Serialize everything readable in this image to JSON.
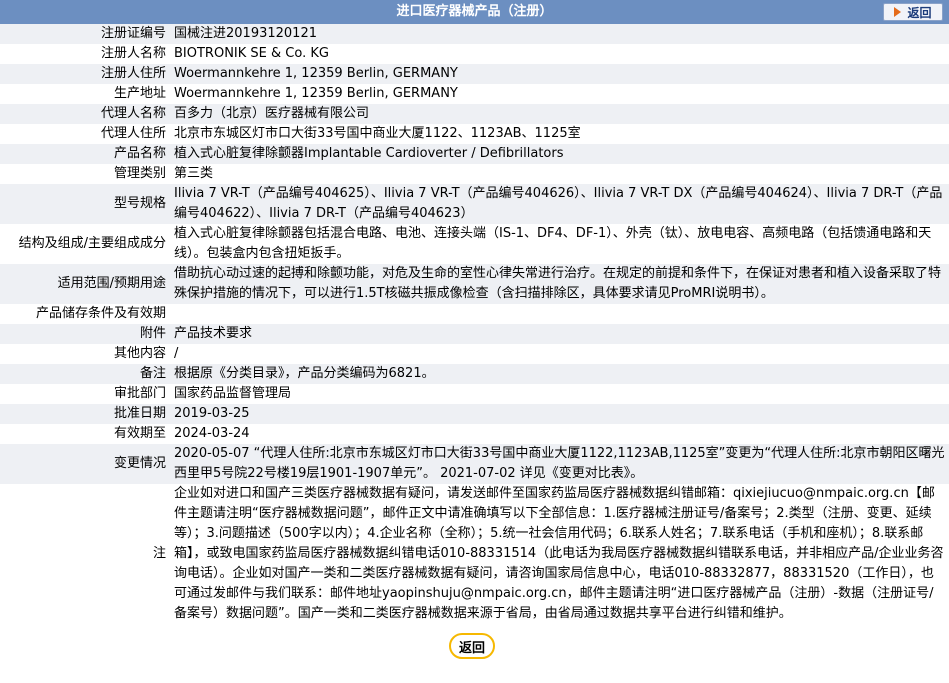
{
  "header": {
    "title": "进口医疗器械产品（注册）",
    "back_label": "返回"
  },
  "rows": [
    {
      "k": "注册证编号",
      "v": "国械注进20193120121"
    },
    {
      "k": "注册人名称",
      "v": "BIOTRONIK SE & Co. KG"
    },
    {
      "k": "注册人住所",
      "v": "Woermannkehre 1, 12359 Berlin, GERMANY"
    },
    {
      "k": "生产地址",
      "v": "Woermannkehre 1, 12359 Berlin, GERMANY"
    },
    {
      "k": "代理人名称",
      "v": "百多力（北京）医疗器械有限公司"
    },
    {
      "k": "代理人住所",
      "v": "北京市东城区灯市口大街33号国中商业大厦1122、1123AB、1125室"
    },
    {
      "k": "产品名称",
      "v": "植入式心脏复律除颤器Implantable Cardioverter / Defibrillators"
    },
    {
      "k": "管理类别",
      "v": "第三类"
    },
    {
      "k": "型号规格",
      "v": "Ilivia 7 VR-T（产品编号404625）、Ilivia 7 VR-T（产品编号404626）、Ilivia 7 VR-T DX（产品编号404624）、Ilivia 7 DR-T（产品编号404622）、Ilivia 7 DR-T（产品编号404623）"
    },
    {
      "k": "结构及组成/主要组成成分",
      "v": "植入式心脏复律除颤器包括混合电路、电池、连接头端（IS-1、DF4、DF-1）、外壳（钛）、放电电容、高频电路（包括馈通电路和天线）。包装盒内包含扭矩扳手。"
    },
    {
      "k": "适用范围/预期用途",
      "v": "借助抗心动过速的起搏和除颤功能，对危及生命的室性心律失常进行治疗。在规定的前提和条件下，在保证对患者和植入设备采取了特殊保护措施的情况下，可以进行1.5T核磁共振成像检查（含扫描排除区，具体要求请见ProMRI说明书）。"
    },
    {
      "k": "产品储存条件及有效期",
      "v": ""
    },
    {
      "k": "附件",
      "v": "产品技术要求"
    },
    {
      "k": "其他内容",
      "v": "/"
    },
    {
      "k": "备注",
      "v": "根据原《分类目录》，产品分类编码为6821。"
    },
    {
      "k": "审批部门",
      "v": "国家药品监督管理局"
    },
    {
      "k": "批准日期",
      "v": "2019-03-25"
    },
    {
      "k": "有效期至",
      "v": "2024-03-24"
    },
    {
      "k": "变更情况",
      "v": "2020-05-07 “代理人住所:北京市东城区灯市口大街33号国中商业大厦1122,1123AB,1125室”变更为“代理人住所:北京市朝阳区曙光西里甲5号院22号楼19层1901-1907单元”。 2021-07-02 详见《变更对比表》。"
    },
    {
      "k": "注",
      "v": "企业如对进口和国产三类医疗器械数据有疑问，请发送邮件至国家药监局医疗器械数据纠错邮箱：qixiejiucuo@nmpaic.org.cn【邮件主题请注明“医疗器械数据问题”，邮件正文中请准确填写以下全部信息：1.医疗器械注册证号/备案号；2.类型（注册、变更、延续等）；3.问题描述（500字以内）；4.企业名称（全称）；5.统一社会信用代码；6.联系人姓名；7.联系电话（手机和座机）；8.联系邮箱】，或致电国家药监局医疗器械数据纠错电话010-88331514（此电话为我局医疗器械数据纠错联系电话，并非相应产品/企业业务咨询电话）。企业如对国产一类和二类医疗器械数据有疑问，请咨询国家局信息中心，电话010-88332877，88331520（工作日），也可通过发邮件与我们联系：邮件地址yaopinshuju@nmpaic.org.cn，邮件主题请注明“进口医疗器械产品（注册）-数据（注册证号/备案号）数据问题”。国产一类和二类医疗器械数据来源于省局，由省局通过数据共享平台进行纠错和维护。"
    }
  ],
  "footer": {
    "back_label": "返回"
  }
}
